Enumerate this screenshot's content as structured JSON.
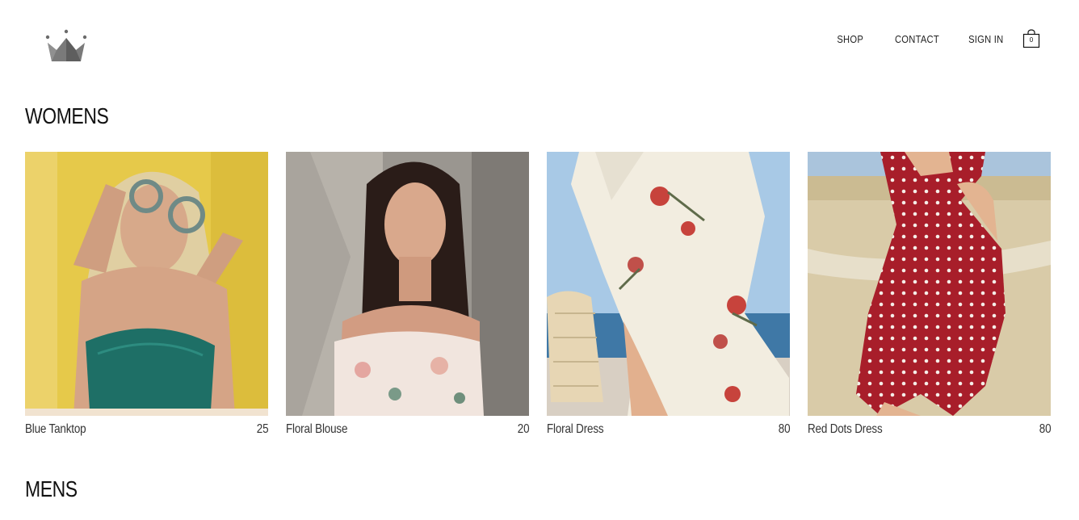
{
  "nav": {
    "shop": "SHOP",
    "contact": "CONTACT",
    "sign_in": "SIGN IN",
    "cart_count": "0"
  },
  "sections": {
    "womens": {
      "title": "WOMENS",
      "products": [
        {
          "name": "Blue Tanktop",
          "price": "25"
        },
        {
          "name": "Floral Blouse",
          "price": "20"
        },
        {
          "name": "Floral Dress",
          "price": "80"
        },
        {
          "name": "Red Dots Dress",
          "price": "80"
        }
      ]
    },
    "mens": {
      "title": "MENS"
    }
  },
  "icons": {
    "logo": "crown-icon",
    "cart": "shopping-bag-icon"
  },
  "colors": {
    "logo_gray": "#808080",
    "text": "#111111"
  }
}
